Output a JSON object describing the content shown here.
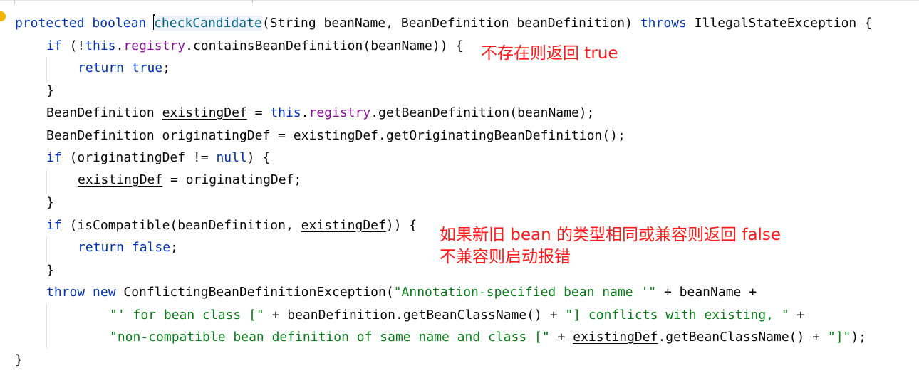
{
  "code": {
    "l1": {
      "t1": "protected",
      "t2": " ",
      "t3": "boolean",
      "t4": " ",
      "t5": "checkCandidate",
      "t6": "(String beanName, BeanDefinition beanDefinition) ",
      "t7": "throws",
      "t8": " IllegalStateException {"
    },
    "l2": {
      "t1": "if",
      "t2": " (!",
      "t3": "this",
      "t4": ".",
      "t5": "registry",
      "t6": ".containsBeanDefinition(beanName)) {"
    },
    "l3": {
      "t1": "return",
      "t2": " ",
      "t3": "true",
      "t4": ";"
    },
    "l4": {
      "t1": "}"
    },
    "l5": {
      "t1": "BeanDefinition ",
      "t2": "existingDef",
      "t3": " = ",
      "t4": "this",
      "t5": ".",
      "t6": "registry",
      "t7": ".getBeanDefinition(beanName);"
    },
    "l6": {
      "t1": "BeanDefinition originatingDef = ",
      "t2": "existingDef",
      "t3": ".getOriginatingBeanDefinition();"
    },
    "l7": {
      "t1": "if",
      "t2": " (originatingDef != ",
      "t3": "null",
      "t4": ") {"
    },
    "l8": {
      "t1": "existingDef",
      "t2": " = originatingDef;"
    },
    "l9": {
      "t1": "}"
    },
    "l10": {
      "t1": "if",
      "t2": " (isCompatible(beanDefinition, ",
      "t3": "existingDef",
      "t4": ")) {"
    },
    "l11": {
      "t1": "return",
      "t2": " ",
      "t3": "false",
      "t4": ";"
    },
    "l12": {
      "t1": "}"
    },
    "l13": {
      "t1": "throw",
      "t2": " ",
      "t3": "new",
      "t4": " ConflictingBeanDefinitionException(",
      "t5": "\"Annotation-specified bean name '\"",
      "t6": " + beanName +"
    },
    "l14": {
      "t1": "\"' for bean class [\"",
      "t2": " + beanDefinition.getBeanClassName() + ",
      "t3": "\"] conflicts with existing, \"",
      "t4": " +"
    },
    "l15": {
      "t1": "\"non-compatible bean definition of same name and class [\"",
      "t2": " + ",
      "t3": "existingDef",
      "t4": ".getBeanClassName() + ",
      "t5": "\"]\"",
      "t6": ");"
    },
    "l16": {
      "t1": "}"
    }
  },
  "annotations": {
    "note1": "不存在则返回 true",
    "note2_line1": "如果新旧 bean 的类型相同或兼容则返回 false",
    "note2_line2": "不兼容则启动报错"
  },
  "gutter": {
    "icon": "lightbulb-icon"
  },
  "colors": {
    "keyword": "#0033b3",
    "field": "#871094",
    "string": "#067d17",
    "method_declaration": "#00627a",
    "annotation_text": "#ff1a1a",
    "default_text": "#080808"
  }
}
